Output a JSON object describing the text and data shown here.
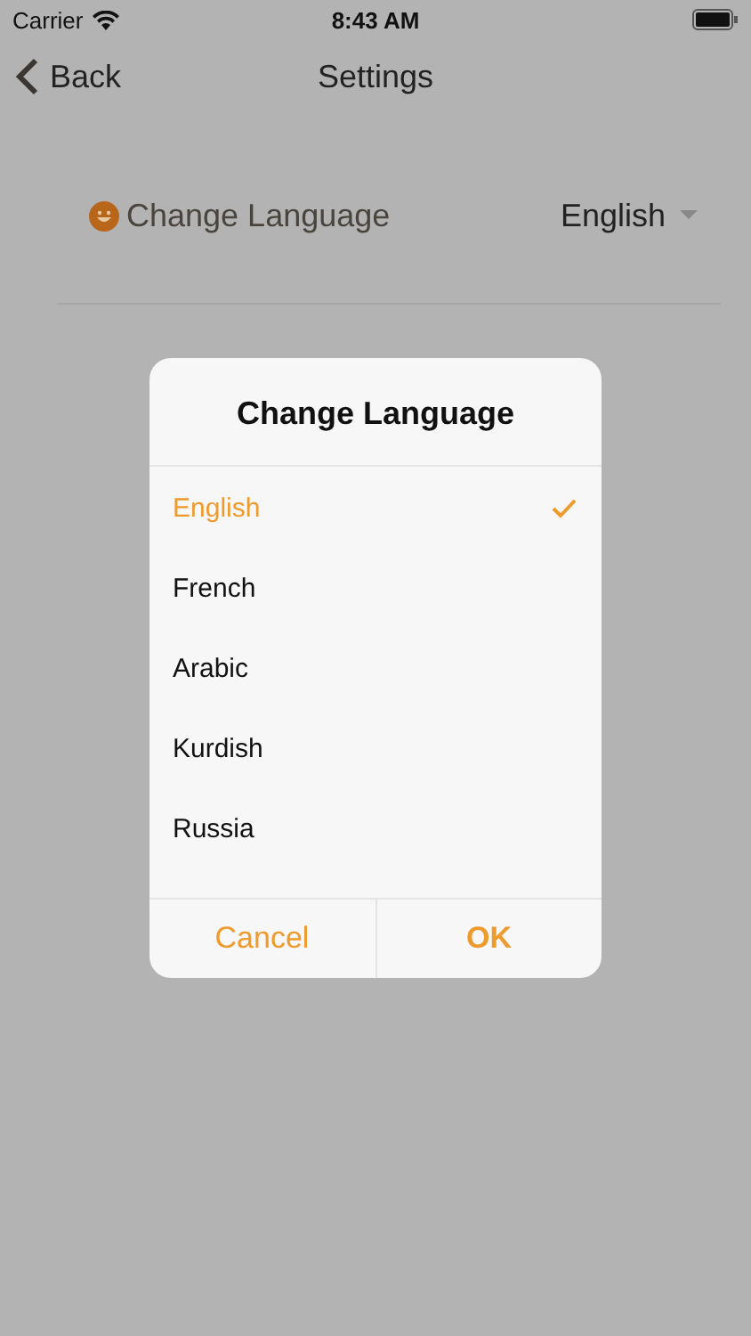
{
  "status_bar": {
    "carrier": "Carrier",
    "time": "8:43 AM"
  },
  "nav": {
    "back": "Back",
    "title": "Settings"
  },
  "setting": {
    "label": "Change Language",
    "value": "English"
  },
  "dialog": {
    "title": "Change Language",
    "options": [
      {
        "label": "English",
        "selected": true
      },
      {
        "label": "French",
        "selected": false
      },
      {
        "label": "Arabic",
        "selected": false
      },
      {
        "label": "Kurdish",
        "selected": false
      },
      {
        "label": "Russia",
        "selected": false
      }
    ],
    "buttons": [
      {
        "label": "Cancel",
        "kind": "cancel"
      },
      {
        "label": "OK",
        "kind": "confirm"
      }
    ]
  }
}
